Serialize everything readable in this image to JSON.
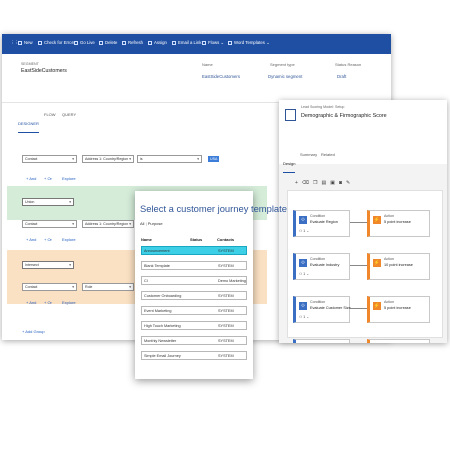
{
  "segment_window": {
    "commands": [
      "New",
      "Check for Errors",
      "Go Live",
      "Delete",
      "Refresh",
      "Assign",
      "Email a Link",
      "Flows",
      "Word Templates"
    ],
    "entity_label": "SEGMENT",
    "title": "EastSideCustomers",
    "fields": {
      "name_label": "Name",
      "name_value": "EastSideCustomers",
      "type_label": "Segment type",
      "type_value": "Dynamic segment",
      "status_label": "Status Reason",
      "status_value": "Draft"
    },
    "tabs": [
      "DESIGNER",
      "FLOW",
      "QUERY"
    ],
    "groups": [
      {
        "entity": "Contact",
        "attribute": "Address 1: Country/Region",
        "operator": "is",
        "value_tag": "USA",
        "and": "+ And",
        "or": "+ Or",
        "explore": "Explore"
      },
      {
        "connector": "Union"
      },
      {
        "entity": "Contact",
        "attribute": "Address 1: Country/Region",
        "and": "+ And",
        "or": "+ Or",
        "explore": "Explore"
      },
      {
        "connector": "Intersect"
      },
      {
        "entity": "Contact",
        "attribute": "Role",
        "and": "+ And",
        "or": "+ Or",
        "explore": "Explore"
      }
    ],
    "add_group": "+ Add Group"
  },
  "template_dialog": {
    "title": "Select a customer journey template",
    "filters": [
      "All",
      "Purpose"
    ],
    "columns": [
      "Name",
      "Status",
      "Contacts"
    ],
    "rows": [
      {
        "name": "Announcement",
        "status": "",
        "contacts": "SYSTEM",
        "selected": true
      },
      {
        "name": "Blank Template",
        "status": "",
        "contacts": "SYSTEM"
      },
      {
        "name": "CI",
        "status": "",
        "contacts": "Demo Marketing"
      },
      {
        "name": "Customer Onboarding",
        "status": "",
        "contacts": "SYSTEM"
      },
      {
        "name": "Event Marketing",
        "status": "",
        "contacts": "SYSTEM"
      },
      {
        "name": "High Touch Marketing",
        "status": "",
        "contacts": "SYSTEM"
      },
      {
        "name": "Monthly Newsletter",
        "status": "",
        "contacts": "SYSTEM"
      },
      {
        "name": "Simple Email Journey",
        "status": "",
        "contacts": "SYSTEM"
      }
    ]
  },
  "scoring_window": {
    "entity_label": "Lead Scoring Model: Setup",
    "title": "Demographic & Firmographic Score",
    "tabs": [
      "Design",
      "Summary",
      "Related"
    ],
    "rules": [
      {
        "cond_title": "Condition",
        "cond_text": "Evaluate Region",
        "action_title": "Action",
        "action_text": "5 point increase"
      },
      {
        "cond_title": "Condition",
        "cond_text": "Evaluate Industry",
        "action_title": "Action",
        "action_text": "10 point increase"
      },
      {
        "cond_title": "Condition",
        "cond_text": "Evaluate Customer Size",
        "action_title": "Action",
        "action_text": "5 point increase"
      },
      {
        "cond_title": "Condition",
        "cond_text": "Evaluate Purchase Urgency",
        "action_title": "Action",
        "action_text": "4 point increase"
      }
    ],
    "rule_count": "1"
  },
  "colors": {
    "command_bar": "#1f4fa3",
    "green_band": "#d5ecd9",
    "peach_band": "#fbe1c3",
    "condition": "#3b6fc4",
    "action": "#f0872b",
    "selected_row": "#3ccfe6"
  }
}
